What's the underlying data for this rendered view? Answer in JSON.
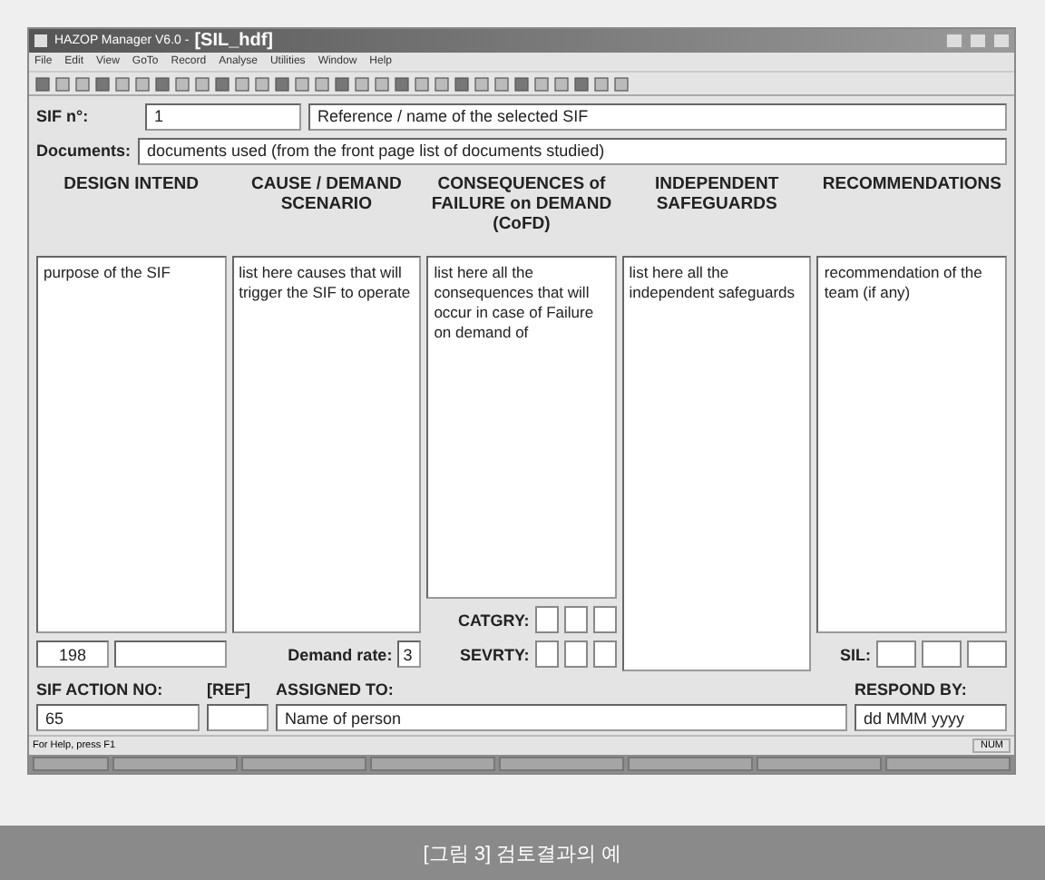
{
  "window": {
    "app_title": "HAZOP Manager V6.0 -",
    "document_title": "[SIL_hdf]"
  },
  "menu": [
    "File",
    "Edit",
    "View",
    "GoTo",
    "Record",
    "Analyse",
    "Utilities",
    "Window",
    "Help"
  ],
  "sif": {
    "label": "SIF n°:",
    "number": "1",
    "reference": "Reference / name of the selected SIF"
  },
  "documents": {
    "label": "Documents:",
    "value": "documents used (from the front page list of documents studied)"
  },
  "columns": [
    {
      "heading": "DESIGN INTEND",
      "text": "purpose of the SIF"
    },
    {
      "heading": "CAUSE / DEMAND SCENARIO",
      "text": "list here causes that will trigger the SIF to operate"
    },
    {
      "heading": "CONSEQUENCES of FAILURE on DEMAND (CoFD)",
      "text": "list here all the consequences that will occur in case of Failure on demand of"
    },
    {
      "heading": "INDEPENDENT SAFEGUARDS",
      "text": "list here all the independent safeguards"
    },
    {
      "heading": "RECOMMENDATIONS",
      "text": "recommendation of the team (if any)"
    }
  ],
  "record_number": "198",
  "demand_rate": {
    "label": "Demand rate:",
    "value": "3"
  },
  "catgry_label": "CATGRY:",
  "sevrty_label": "SEVRTY:",
  "sil_label": "SIL:",
  "action": {
    "number_label": "SIF ACTION NO:",
    "number": "65",
    "ref_label": "[REF]",
    "assigned_label": "ASSIGNED TO:",
    "assigned": "Name of person",
    "respond_label": "RESPOND BY:",
    "respond": "dd MMM yyyy"
  },
  "status_bar": {
    "help": "For Help, press F1",
    "num": "NUM"
  },
  "caption": "[그림 3] 검토결과의 예"
}
